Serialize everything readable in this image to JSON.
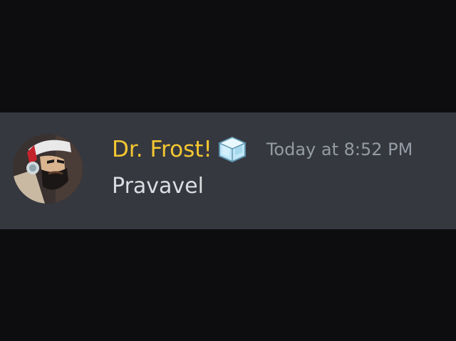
{
  "message": {
    "author": {
      "display_name": "Dr. Frost!",
      "name_color": "#f5c731",
      "avatar_icon": "avatar-icon",
      "badge_icon": "ice-cube-icon"
    },
    "timestamp": "Today at 8:52 PM",
    "content": "Pravavel"
  },
  "colors": {
    "background": "#0d0d0f",
    "message_row_background": "#36383f",
    "timestamp": "#949ba4",
    "message_text": "#dbdee1"
  }
}
